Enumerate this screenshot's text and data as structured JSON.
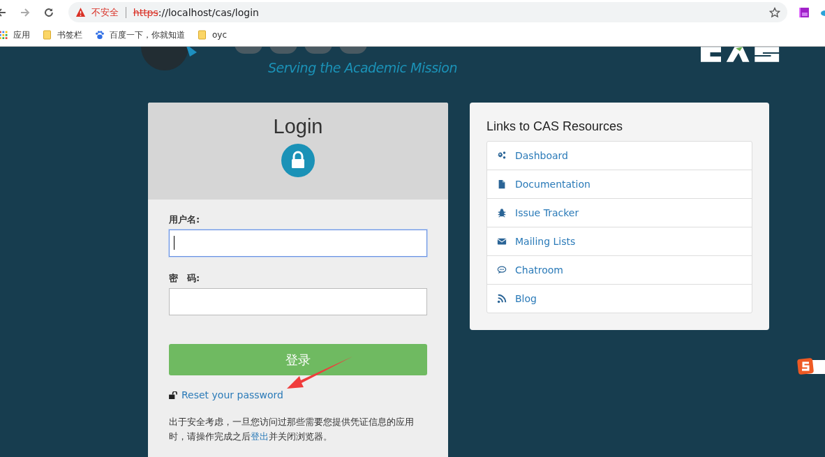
{
  "browser": {
    "security_label": "不安全",
    "url_scheme": "https",
    "url_rest": "://localhost/cas/login",
    "bookmarks": [
      {
        "label": "应用",
        "kind": "apps"
      },
      {
        "label": "书签栏",
        "kind": "folder"
      },
      {
        "label": "百度一下，你就知道",
        "kind": "paw"
      },
      {
        "label": "oyc",
        "kind": "folder"
      }
    ]
  },
  "header": {
    "tagline": "Serving the Academic Mission"
  },
  "login": {
    "title": "Login",
    "username_label": "用户名:",
    "username_focused": true,
    "password_label": "密　码:",
    "password_focused": false,
    "submit": "登录",
    "reset_link": "Reset your password",
    "notice": {
      "before": "出于安全考虑，一旦您访问过那些需要您提供凭证信息的应用时，请操作完成之后",
      "link": "登出",
      "after": "并关闭浏览器。"
    }
  },
  "resources": {
    "title": "Links to CAS Resources",
    "links": [
      {
        "label": "Dashboard",
        "kind": "gears"
      },
      {
        "label": "Documentation",
        "kind": "file"
      },
      {
        "label": "Issue Tracker",
        "kind": "bug"
      },
      {
        "label": "Mailing Lists",
        "kind": "envelope"
      },
      {
        "label": "Chatroom",
        "kind": "comment"
      },
      {
        "label": "Blog",
        "kind": "rss"
      }
    ]
  }
}
